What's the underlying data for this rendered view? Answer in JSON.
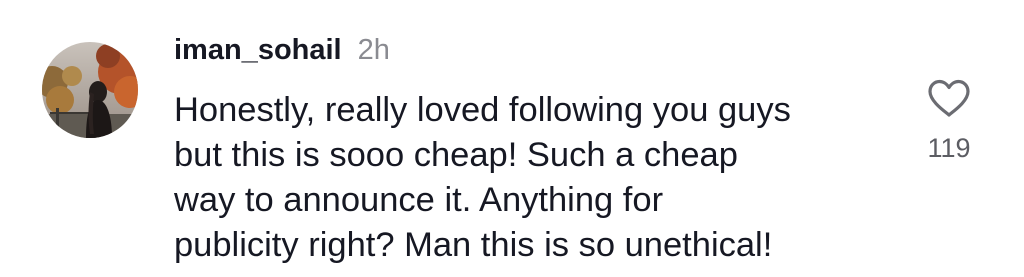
{
  "comment": {
    "username": "iman_sohail",
    "timestamp": "2h",
    "text": "Honestly, really loved following you guys\nbut this is sooo cheap! Such a cheap\nway to announce it. Anything for\npublicity right? Man this is so unethical!",
    "like_count": "119",
    "icons": {
      "avatar": "user-avatar",
      "like": "heart-outline-icon"
    },
    "colors": {
      "text": "#161823",
      "muted": "#8a8b91",
      "icon": "#6b6c72"
    }
  }
}
